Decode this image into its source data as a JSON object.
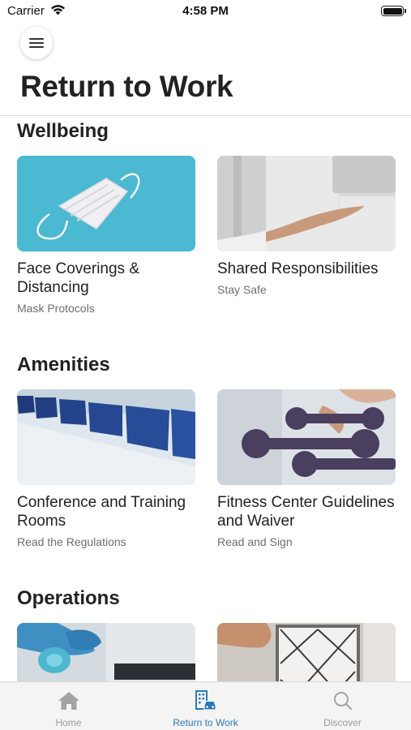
{
  "status_bar": {
    "carrier": "Carrier",
    "time": "4:58 PM"
  },
  "header": {
    "title": "Return to Work",
    "menu_icon": "hamburger-menu-icon"
  },
  "sections": [
    {
      "title": "Wellbeing",
      "cards": [
        {
          "title": "Face Coverings & Distancing",
          "subtitle": "Mask Protocols",
          "image": "face-mask-photo"
        },
        {
          "title": "Shared Responsibilities",
          "subtitle": "Stay Safe",
          "image": "hand-sanitizer-photo"
        }
      ]
    },
    {
      "title": "Amenities",
      "cards": [
        {
          "title": "Conference and Training Rooms",
          "subtitle": "Read the Regulations",
          "image": "conference-room-photo"
        },
        {
          "title": "Fitness Center Guidelines and Waiver",
          "subtitle": "Read and Sign",
          "image": "dumbbells-photo"
        }
      ]
    },
    {
      "title": "Operations",
      "cards": [
        {
          "title": "",
          "subtitle": "",
          "image": "cleaning-spray-photo"
        },
        {
          "title": "",
          "subtitle": "",
          "image": "air-filter-photo"
        }
      ]
    }
  ],
  "tab_bar": {
    "active": "Return to Work",
    "active_color": "#2c78b6",
    "inactive_color": "#9a9a9a",
    "tabs": [
      {
        "label": "Home",
        "icon": "home-icon"
      },
      {
        "label": "Return to Work",
        "icon": "building-car-icon"
      },
      {
        "label": "Discover",
        "icon": "search-icon"
      }
    ]
  }
}
